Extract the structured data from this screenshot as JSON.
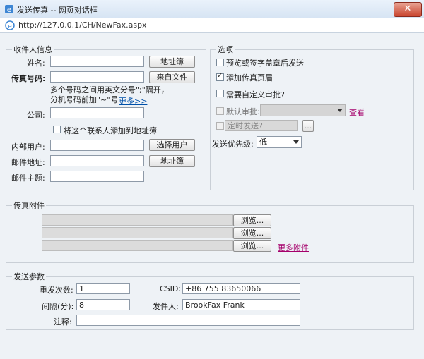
{
  "window": {
    "title": "发送传真 -- 网页对话框",
    "close": "✕"
  },
  "address": {
    "url": "http://127.0.0.1/CH/NewFax.aspx"
  },
  "recipient": {
    "legend": "收件人信息",
    "name_label": "姓名:",
    "name_value": "",
    "address_book_btn": "地址簿",
    "fax_label": "传真号码:",
    "fax_value": "",
    "from_file_btn": "来自文件",
    "hint_line1": "多个号码之间用英文分号\";\"隔开，",
    "hint_line2": "分机号码前加\"~\"号",
    "more_link": "更多>>",
    "company_label": "公司:",
    "company_value": "",
    "add_contact_label": "将这个联系人添加到地址簿",
    "internal_user_label": "内部用户:",
    "internal_user_value": "",
    "select_user_btn": "选择用户",
    "email_label": "邮件地址:",
    "email_value": "",
    "email_book_btn": "地址簿",
    "subject_label": "邮件主题:",
    "subject_value": ""
  },
  "options": {
    "legend": "选项",
    "preview_label": "预览或签字盖章后发送",
    "preview_checked": false,
    "header_label": "添加传真页眉",
    "header_checked": true,
    "custom_approval_label": "需要自定义审批?",
    "custom_approval_checked": false,
    "default_approval_label": "默认审批:",
    "default_approval_value": "",
    "view_link": "查看",
    "timed_label": "定时发送?",
    "timed_button": "...",
    "priority_label": "发送优先级:",
    "priority_value": "低"
  },
  "attachments": {
    "legend": "传真附件",
    "browse_btn": "浏览...",
    "more_link": "更多附件"
  },
  "params": {
    "legend": "发送参数",
    "retry_label": "重发次数:",
    "retry_value": "1",
    "csid_label": "CSID:",
    "csid_value": "+86 755 83650066",
    "interval_label": "间隔(分):",
    "interval_value": "8",
    "sender_label": "发件人:",
    "sender_value": "BrookFax Frank",
    "note_label": "注释:",
    "note_value": ""
  }
}
